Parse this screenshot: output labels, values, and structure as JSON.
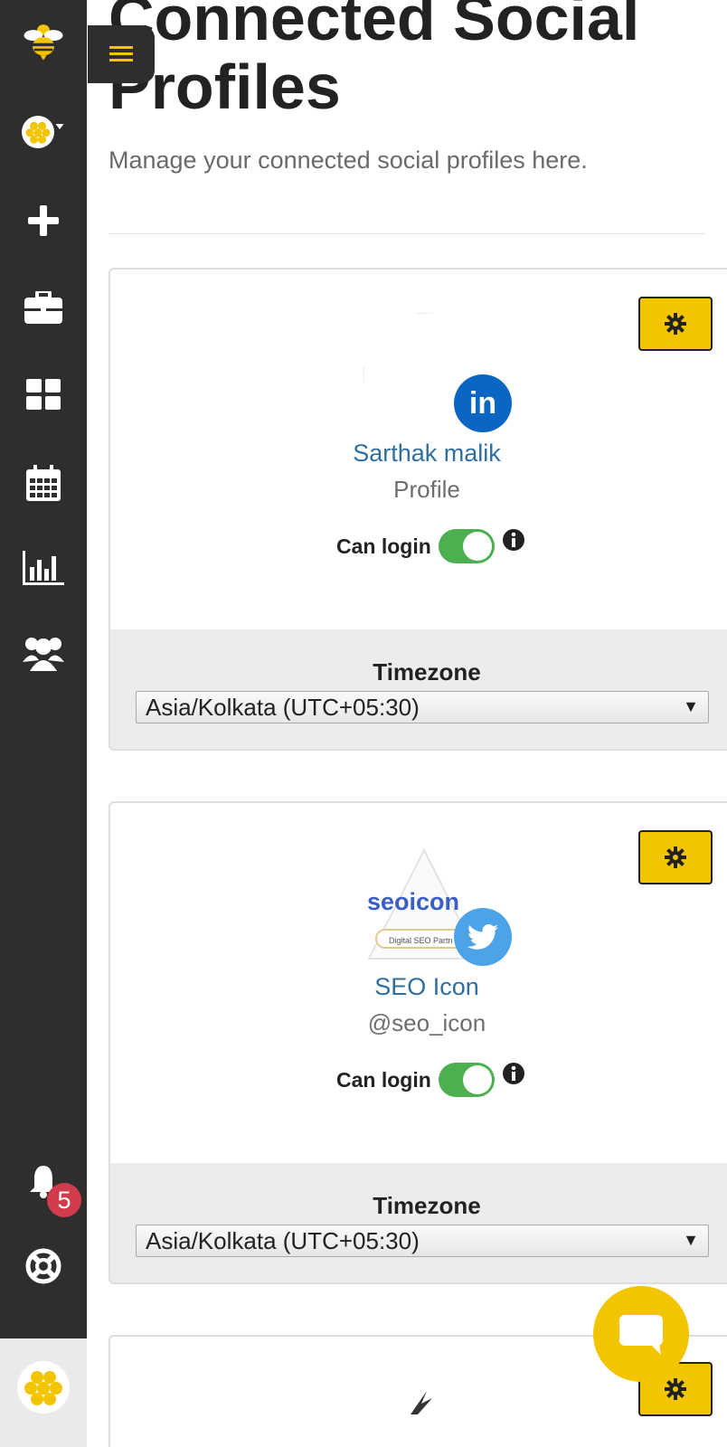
{
  "page": {
    "title": "Connected Social Profiles",
    "subtitle": "Manage your connected social profiles here."
  },
  "sidebar": {
    "notification_count": "5"
  },
  "profiles": [
    {
      "network": "linkedin",
      "name": "Sarthak malik",
      "subtitle": "Profile",
      "can_login_label": "Can login",
      "can_login": true,
      "timezone_label": "Timezone",
      "timezone_value": "Asia/Kolkata (UTC+05:30)"
    },
    {
      "network": "twitter",
      "name": "SEO Icon",
      "subtitle": "@seo_icon",
      "logo_text": "seoicon",
      "logo_tagline": "Digital SEO Partn",
      "can_login_label": "Can login",
      "can_login": true,
      "timezone_label": "Timezone",
      "timezone_value": "Asia/Kolkata (UTC+05:30)"
    }
  ],
  "colors": {
    "sidebar_bg": "#2e2e2e",
    "accent": "#f2c500",
    "toggle_on": "#4caf50",
    "link": "#2f6f9f",
    "linkedin": "#0a66c2",
    "twitter": "#4da3e8",
    "badge": "#d23b4b"
  }
}
